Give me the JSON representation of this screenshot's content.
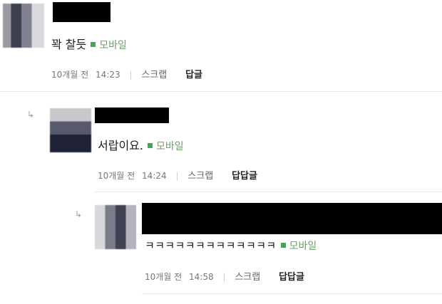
{
  "comments": [
    {
      "body": "꽉 찰듯",
      "mobile_label": "모바일",
      "date": "10개월 전",
      "time": "14:23",
      "scrap_label": "스크랩",
      "reply_label": "답글"
    },
    {
      "body": "서랍이요.",
      "mobile_label": "모바일",
      "date": "10개월 전",
      "time": "14:24",
      "scrap_label": "스크랩",
      "reply_label": "답답글"
    },
    {
      "body": "ㅋㅋㅋㅋㅋㅋㅋㅋㅋㅋㅋㅋㅋ",
      "mobile_label": "모바일",
      "date": "10개월 전",
      "time": "14:58",
      "scrap_label": "스크랩",
      "reply_label": "답답글"
    }
  ],
  "icons": {
    "reply_arrow": "reply-arrow-icon",
    "mobile": "mobile-indicator-icon"
  },
  "colors": {
    "mobile_green": "#3faa52",
    "redaction": "#000000",
    "divider": "#e6e6e6"
  }
}
